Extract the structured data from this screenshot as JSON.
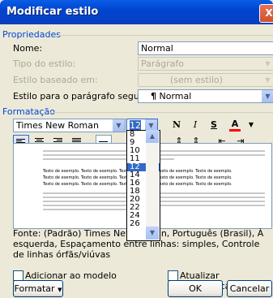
{
  "window": {
    "title": "Modificar estilo",
    "close_glyph": "X"
  },
  "properties": {
    "section_label": "Propriedades",
    "name_label": "Nome:",
    "name_value": "Normal",
    "style_type_label": "Tipo do estilo:",
    "style_type_value": "Parágrafo",
    "based_on_label": "Estilo baseado em:",
    "based_on_value": "(sem estilo)",
    "next_style_label": "Estilo para o parágrafo seguinte:",
    "next_style_value": "Normal",
    "next_style_glyph": "¶"
  },
  "formatting": {
    "section_label": "Formatação",
    "font_value": "Times New Roman",
    "size_value": "12",
    "bold": "N",
    "italic": "I",
    "underline": "S",
    "font_color": "A"
  },
  "size_list": [
    "8",
    "9",
    "10",
    "11",
    "12",
    "14",
    "16",
    "18",
    "20",
    "22",
    "24",
    "26"
  ],
  "size_selected_index": 4,
  "preview": {
    "sample_text": "Texto de exemplo. Texto de exemplo. Texto de exemplo. Texto de exemplo. Texto de exemplo."
  },
  "description": "Fonte: (Padrão) Times New Roman, Português (Brasil), À esquerda, Espaçamento entre linhas:  simples, Controle de linhas órfãs/viúvas",
  "footer": {
    "add_to_template": "Adicionar ao modelo",
    "auto_update": "Atualizar automaticamente",
    "format_button": "Formatar",
    "ok_button": "OK",
    "cancel_button": "Cancelar"
  },
  "colors": {
    "title_bar": "#0054e3",
    "section_label": "#0046d5",
    "selection": "#316ac5",
    "font_color_bar": "#ff0000"
  }
}
